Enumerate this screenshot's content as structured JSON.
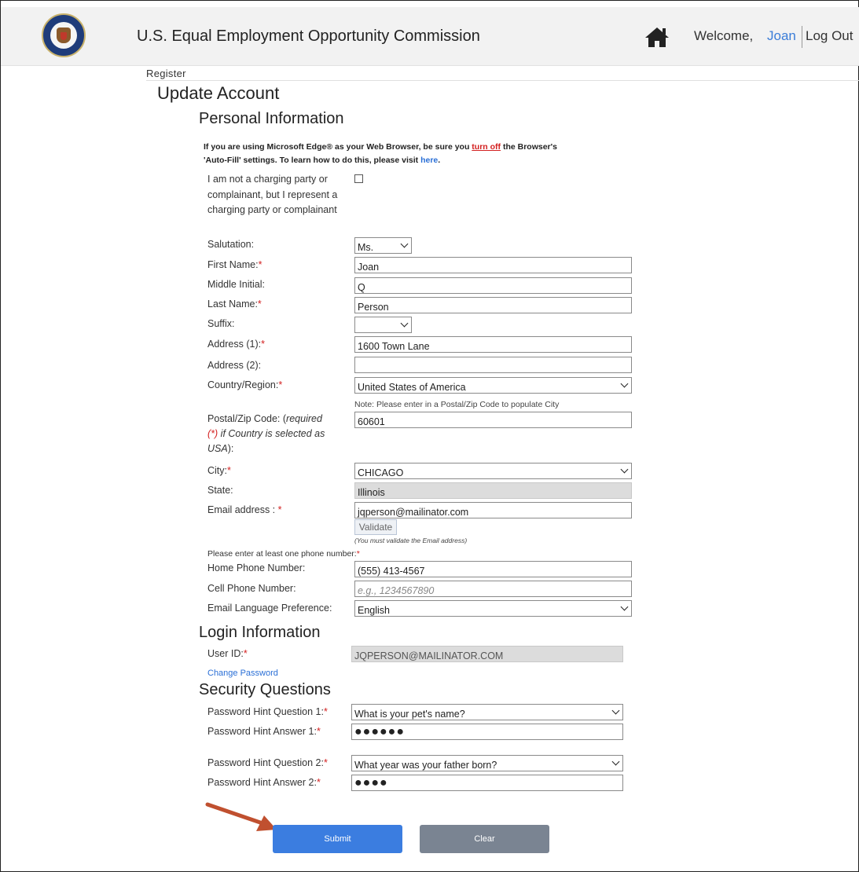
{
  "header": {
    "title": "U.S. Equal Employment Opportunity Commission",
    "welcome": "Welcome,",
    "user_name": "Joan",
    "logout": "Log Out"
  },
  "breadcrumb": "Register",
  "page_title": "Update Account",
  "sections": {
    "personal": "Personal Information",
    "login": "Login Information",
    "security": "Security Questions"
  },
  "notice": {
    "part1": "If you are using Microsoft Edge® as your Web Browser, be sure you ",
    "link_turn_off": "turn off",
    "part2": " the Browser's 'Auto-Fill' settings. To learn how to do this, please visit ",
    "link_here": "here",
    "part3": "."
  },
  "fields": {
    "represent_label": "I am not a charging party or complainant, but I represent a charging party or complainant",
    "salutation": {
      "label": "Salutation:",
      "value": "Ms."
    },
    "first_name": {
      "label": "First Name:",
      "value": "Joan"
    },
    "middle_initial": {
      "label": "Middle Initial:",
      "value": "Q"
    },
    "last_name": {
      "label": "Last Name:",
      "value": "Person"
    },
    "suffix": {
      "label": "Suffix:",
      "value": ""
    },
    "address1": {
      "label": "Address (1):",
      "value": "1600 Town Lane"
    },
    "address2": {
      "label": "Address (2):",
      "value": ""
    },
    "country": {
      "label": "Country/Region:",
      "value": "United States of America"
    },
    "postal_note": "Note: Please enter in a Postal/Zip Code to populate City",
    "postal": {
      "label_a": "Postal/Zip Code: (",
      "label_b": "required",
      "label_c": "(*) if Country is selected as",
      "label_d": "USA",
      "label_e": "):",
      "value": "60601"
    },
    "city": {
      "label": "City:",
      "value": "CHICAGO"
    },
    "state": {
      "label": "State:",
      "value": "Illinois"
    },
    "email": {
      "label": "Email address : ",
      "value": "jqperson@mailinator.com"
    },
    "validate_button": "Validate",
    "validate_note": "(You must validate the Email address)",
    "phone_note": "Please enter at least one phone number:",
    "home_phone": {
      "label": "Home Phone Number:",
      "value": "(555) 413-4567"
    },
    "cell_phone": {
      "label": "Cell Phone Number:",
      "placeholder": "e.g., 1234567890"
    },
    "language": {
      "label": "Email Language Preference:",
      "value": "English"
    },
    "user_id": {
      "label": "User ID:",
      "value": "JQPERSON@MAILINATOR.COM"
    },
    "change_password": "Change Password",
    "hint_q1": {
      "label": "Password Hint Question 1:",
      "value": "What is your pet's name?"
    },
    "hint_a1": {
      "label": "Password Hint Answer 1:",
      "value": "●●●●●●"
    },
    "hint_q2": {
      "label": "Password Hint Question 2:",
      "value": "What year was your father born?"
    },
    "hint_a2": {
      "label": "Password Hint Answer 2:",
      "value": "●●●●"
    }
  },
  "buttons": {
    "submit": "Submit",
    "clear": "Clear"
  },
  "required_mark": "*",
  "colors": {
    "accent": "#3b7de0",
    "required": "#d32020",
    "link": "#2a6fd6",
    "clear": "#7a8492",
    "arrow": "#c0502f"
  }
}
